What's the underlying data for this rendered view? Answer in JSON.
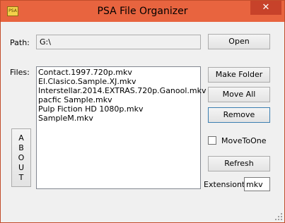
{
  "window": {
    "title": "PSA File Organizer",
    "icon_name": "app-folder-icon",
    "minimize_glyph": "",
    "maximize_glyph": "",
    "close_glyph": "✕"
  },
  "path": {
    "label": "Path:",
    "value": "G:\\",
    "open_label": "Open"
  },
  "files": {
    "label": "Files:",
    "items": [
      "Contact.1997.720p.mkv",
      "El.Clasico.Sample.XJ.mkv",
      "Interstellar.2014.EXTRAS.720p.Ganool.mkv",
      "pacfic Sample.mkv",
      "Pulp Fiction HD 1080p.mkv",
      "SampleM.mkv"
    ]
  },
  "about": {
    "letters": [
      "A",
      "B",
      "O",
      "U",
      "T"
    ]
  },
  "actions": {
    "make_folder": "Make Folder",
    "move_all": "Move All",
    "remove": "Remove",
    "move_to_one": "MoveToOne",
    "move_to_one_checked": false,
    "refresh": "Refresh"
  },
  "extension": {
    "label": "Extensiont:",
    "value": "mkv"
  },
  "colors": {
    "titlebar": "#e8643f",
    "close_button": "#c7422a",
    "window_bg": "#f0f0f0"
  }
}
